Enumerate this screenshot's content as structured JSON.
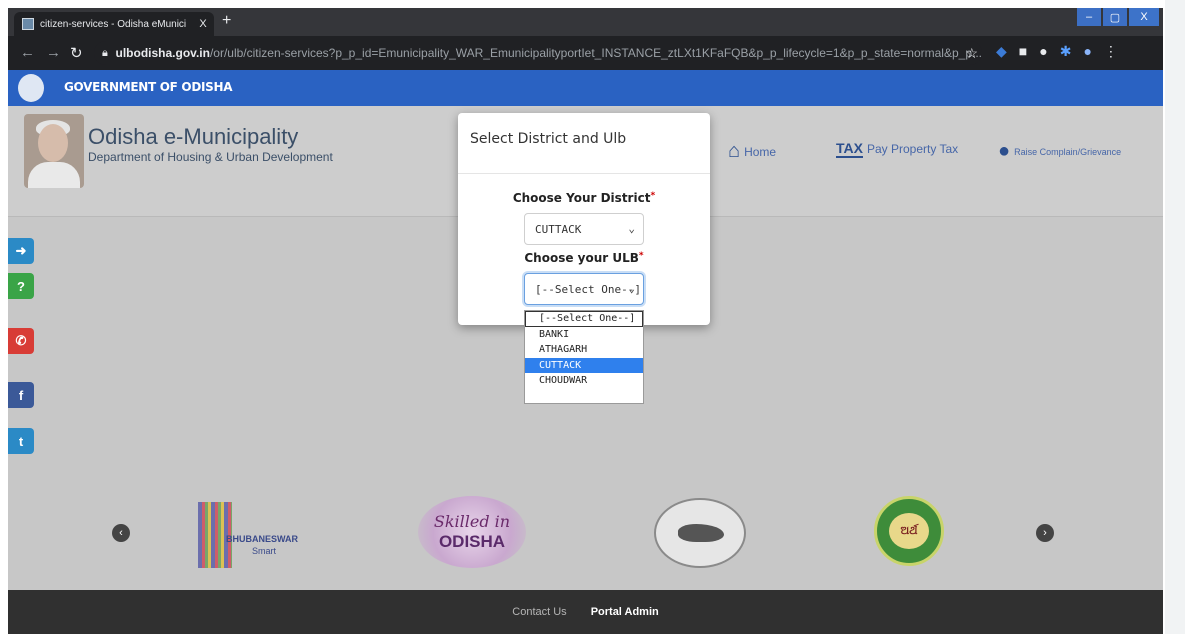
{
  "browser": {
    "tab_title": "citizen-services - Odisha eMunici",
    "tab_close": "X",
    "new_tab": "+",
    "window_min": "–",
    "window_max": "▢",
    "window_close": "X",
    "url_domain": "ulbodisha.gov.in",
    "url_path": "/or/ulb/citizen-services?p_p_id=Emunicipality_WAR_EmunicipalityportIet_INSTANCE_ztLXt1KFaFQB&p_p_lifecycle=1&p_p_state=normal&p_p...",
    "bookmark_icon": "star-icon"
  },
  "gov_bar": {
    "title": "GOVERNMENT OF ODISHA"
  },
  "header": {
    "site_name": "Odisha e-Municipality",
    "site_subtitle": "Department of Housing & Urban Development",
    "nav": [
      {
        "label": "Home",
        "icon": "home-icon"
      },
      {
        "label": "Pay Property Tax",
        "icon": "tax-icon"
      },
      {
        "label": "Raise Complain/Grievance",
        "icon": "user-icon"
      }
    ]
  },
  "social": [
    {
      "icon": "login-icon",
      "glyph": "➜",
      "color": "#2b8ac6"
    },
    {
      "icon": "help-icon",
      "glyph": "?",
      "color": "#3aa447"
    },
    {
      "icon": "phone-icon",
      "glyph": "✆",
      "color": "#d83c36"
    },
    {
      "icon": "facebook-icon",
      "glyph": "f",
      "color": "#3b5998"
    },
    {
      "icon": "twitter-icon",
      "glyph": "t",
      "color": "#2b8ac6"
    }
  ],
  "logos": {
    "bhubaneswar": "BHUBANESWAR",
    "bhubaneswar_sub": "Smart",
    "skilled_line1": "Skilled in",
    "skilled_line2": "ODISHA",
    "emblem": "emblem-logo",
    "odia": "ଅର୍ଥ"
  },
  "carousel": {
    "prev": "‹",
    "next": "›"
  },
  "footer": {
    "contact": "Contact Us",
    "admin": "Portal Admin"
  },
  "modal": {
    "title": "Select District and Ulb",
    "district_label": "Choose Your District",
    "district_value": "CUTTACK",
    "ulb_label": "Choose your ULB",
    "ulb_value": "[--Select One--]",
    "required_mark": "*",
    "ulb_options": [
      "[--Select One--]",
      "BANKI",
      "ATHAGARH",
      "CUTTACK",
      "CHOUDWAR"
    ],
    "highlighted_option": "CUTTACK"
  }
}
